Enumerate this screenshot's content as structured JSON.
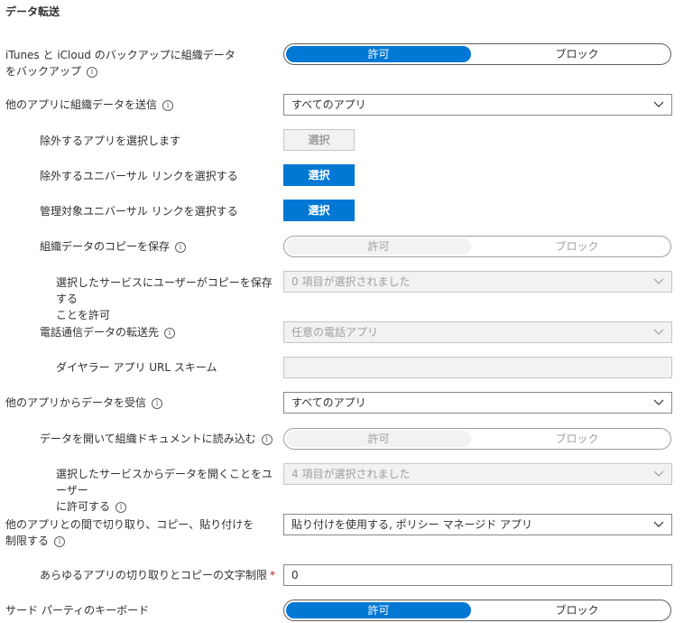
{
  "section_title": "データ転送",
  "info_glyph": "i",
  "toggle_labels": {
    "allow": "許可",
    "block": "ブロック"
  },
  "select_button_label": "選択",
  "rows": {
    "itunes_backup": {
      "label_line1": "iTunes と iCloud のバックアップに組織データ",
      "label_line2": "をバックアップ",
      "value": "許可"
    },
    "send_org_data": {
      "label": "他のアプリに組織データを送信",
      "value": "すべてのアプリ"
    },
    "exempt_apps": {
      "label": "除外するアプリを選択します"
    },
    "exempt_universal_links": {
      "label": "除外するユニバーサル リンクを選択する"
    },
    "managed_universal_links": {
      "label": "管理対象ユニバーサル リンクを選択する"
    },
    "save_copies": {
      "label": "組織データのコピーを保存",
      "value": "許可"
    },
    "save_services": {
      "label_line1": "選択したサービスにユーザーがコピーを保存する",
      "label_line2": "ことを許可",
      "value": "0 項目が選択されました"
    },
    "telecom_transfer": {
      "label": "電話通信データの転送先",
      "value": "任意の電話アプリ"
    },
    "dialer_url": {
      "label": "ダイヤラー アプリ URL スキーム",
      "value": ""
    },
    "receive_data": {
      "label": "他のアプリからデータを受信",
      "value": "すべてのアプリ"
    },
    "open_into_org": {
      "label": "データを開いて組織ドキュメントに読み込む",
      "value": "許可"
    },
    "open_services": {
      "label_line1": "選択したサービスからデータを開くことをユーザー",
      "label_line2": "に許可する",
      "value": "4 項目が選択されました"
    },
    "cut_copy_paste": {
      "label_line1": "他のアプリとの間で切り取り、コピー、貼り付けを",
      "label_line2": "制限する",
      "value": "貼り付けを使用する, ポリシー マネージド アプリ"
    },
    "char_limit": {
      "label": "あらゆるアプリの切り取りとコピーの文字制限",
      "required_mark": "*",
      "value": "0"
    },
    "third_party_keyboard": {
      "label": "サード パーティのキーボード",
      "value": "許可"
    }
  },
  "colors": {
    "accent": "#0078d4",
    "disabled_bg": "#f3f2f1",
    "disabled_text": "#a19f9d",
    "required": "#a4262c"
  }
}
